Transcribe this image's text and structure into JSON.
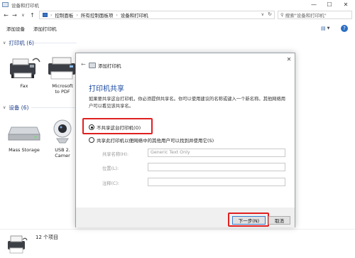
{
  "window": {
    "title": "设备和打印机",
    "controls": {
      "minimize": "—",
      "maximize": "☐",
      "close": "✕"
    }
  },
  "address": {
    "crumbs": [
      "控制面板",
      "所有控制面板项",
      "设备和打印机"
    ],
    "search_placeholder": "搜索\"设备和打印机\""
  },
  "commands": [
    "添加设备",
    "添加打印机"
  ],
  "groups": {
    "printers": {
      "label": "打印机 (6)"
    },
    "devices": {
      "label": "设备 (6)"
    }
  },
  "printers": [
    {
      "label": "Fax",
      "icon": "fax-printer-icon"
    },
    {
      "label": "Microsoft\nto PDF",
      "icon": "printer-icon"
    }
  ],
  "devices": [
    {
      "label": "Mass Storage",
      "icon": "drive-icon"
    },
    {
      "label": "USB 2.\nCamer",
      "icon": "webcam-icon"
    }
  ],
  "status": {
    "count": "12 个项目"
  },
  "dialog": {
    "title": "添加打印机",
    "heading": "打印机共享",
    "description": "如果要共享这台打印机，你必须提供共享名。你可以使用建议的名称或键入一个新名称。其他网络用户可以看见该共享名。",
    "options": [
      {
        "label": "不共享这台打印机(O)",
        "selected": true
      },
      {
        "label": "共享此打印机以便网络中的其他用户可以找到并使用它(S)",
        "selected": false
      }
    ],
    "fields": [
      {
        "label": "共享名称(H):",
        "value": "Generic  Text Only"
      },
      {
        "label": "位置(L):",
        "value": ""
      },
      {
        "label": "注释(C):",
        "value": ""
      }
    ],
    "buttons": {
      "next": "下一步(N)",
      "cancel": "取消"
    },
    "highlight_color": "#e02020"
  }
}
